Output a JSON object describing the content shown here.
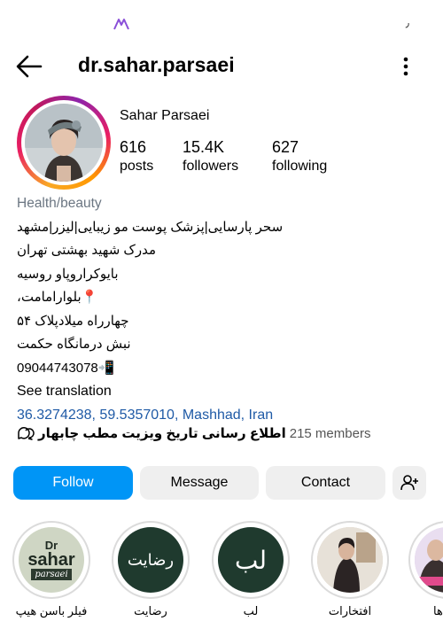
{
  "status_bar": {
    "right_glyph": "٫"
  },
  "header": {
    "username": "dr.sahar.parsaei"
  },
  "profile": {
    "display_name": "Sahar Parsaei",
    "stats": [
      {
        "value": "616",
        "label": "posts"
      },
      {
        "value": "15.4K",
        "label": "followers"
      },
      {
        "value": "627",
        "label": "following"
      }
    ]
  },
  "bio": {
    "category": "Health/beauty",
    "lines": [
      "سحر پارسایی|پزشک پوست مو زیبایی|لیزر|مشهد",
      "مدرک شهید بهشتی تهران",
      "بایوکراروپاو روسیه",
      "📍بلوارامامت،",
      "چهارراه میلادپلاک ۵۴",
      "نبش درمانگاه حکمت",
      "09044743078📲"
    ],
    "see_translation": "See translation",
    "location": "36.3274238, 59.5357010, Mashhad, Iran"
  },
  "channel": {
    "title": "اطلاع رسانی تاریخ ویزیت مطب چابهار",
    "members": "215 members"
  },
  "buttons": {
    "follow": "Follow",
    "message": "Message",
    "contact": "Contact"
  },
  "highlights": [
    {
      "label": "فیلر باسن هیپ",
      "logo_line1": "Dr",
      "logo_line2": "sahar",
      "logo_line3": "parsaei"
    },
    {
      "label": "رضایت",
      "text": "رضایت"
    },
    {
      "label": "لب",
      "text": "لب"
    },
    {
      "label": "افتخارات"
    },
    {
      "label": "ها"
    }
  ],
  "colors": {
    "follow_bg": "#0095f6",
    "secondary_btn_bg": "#efefef",
    "link": "#1f5aa6",
    "category": "#6b7682",
    "highlight_dark": "#1f3a2e"
  },
  "icons": {
    "back": "arrow-left-icon",
    "more": "more-vertical-icon",
    "add_user": "person-add-icon",
    "channel": "chat-bubbles-icon"
  }
}
